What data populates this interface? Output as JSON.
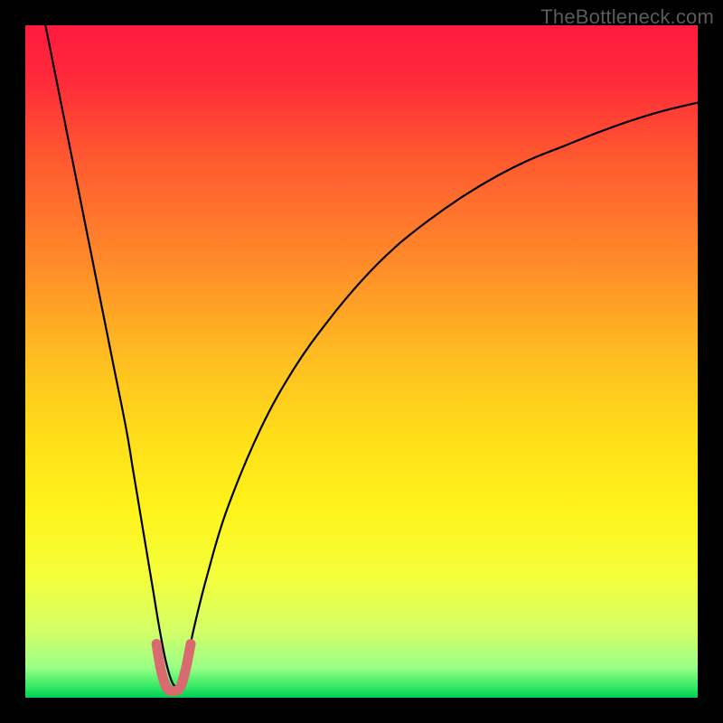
{
  "watermark": "TheBottleneck.com",
  "chart_data": {
    "type": "line",
    "title": "",
    "xlabel": "",
    "ylabel": "",
    "xlim": [
      0,
      100
    ],
    "ylim": [
      0,
      100
    ],
    "grid": false,
    "series": [
      {
        "name": "curve",
        "x": [
          3,
          5,
          7,
          9,
          11,
          13,
          15,
          16,
          17,
          18,
          19,
          20,
          21,
          22,
          23,
          24,
          25,
          27,
          30,
          35,
          40,
          45,
          50,
          55,
          60,
          65,
          70,
          75,
          80,
          85,
          90,
          95,
          100
        ],
        "y": [
          100,
          90,
          80,
          70,
          60,
          50,
          40,
          34,
          28,
          22,
          16,
          10,
          5,
          2,
          2,
          5,
          10,
          18,
          28,
          40,
          49,
          56,
          62,
          67,
          71,
          74.5,
          77.5,
          80,
          82,
          84,
          85.8,
          87.3,
          88.5
        ]
      }
    ],
    "marker_segment": {
      "name": "valley-marker",
      "x": [
        19.5,
        20.2,
        21,
        22,
        23,
        23.8,
        24.6
      ],
      "y": [
        8,
        4,
        1.5,
        1,
        1.5,
        4,
        8
      ]
    },
    "gradient_stops": [
      {
        "offset": 0.0,
        "color": "#ff1a3f"
      },
      {
        "offset": 0.08,
        "color": "#ff2a3a"
      },
      {
        "offset": 0.2,
        "color": "#ff5a2f"
      },
      {
        "offset": 0.35,
        "color": "#ff8a2a"
      },
      {
        "offset": 0.5,
        "color": "#ffbf20"
      },
      {
        "offset": 0.62,
        "color": "#ffe019"
      },
      {
        "offset": 0.72,
        "color": "#fff31a"
      },
      {
        "offset": 0.82,
        "color": "#f4ff3a"
      },
      {
        "offset": 0.9,
        "color": "#d4ff66"
      },
      {
        "offset": 0.955,
        "color": "#9aff86"
      },
      {
        "offset": 0.985,
        "color": "#30e864"
      },
      {
        "offset": 1.0,
        "color": "#00cc55"
      }
    ],
    "marker_color": "#d86b6f",
    "curve_color": "#000000"
  }
}
